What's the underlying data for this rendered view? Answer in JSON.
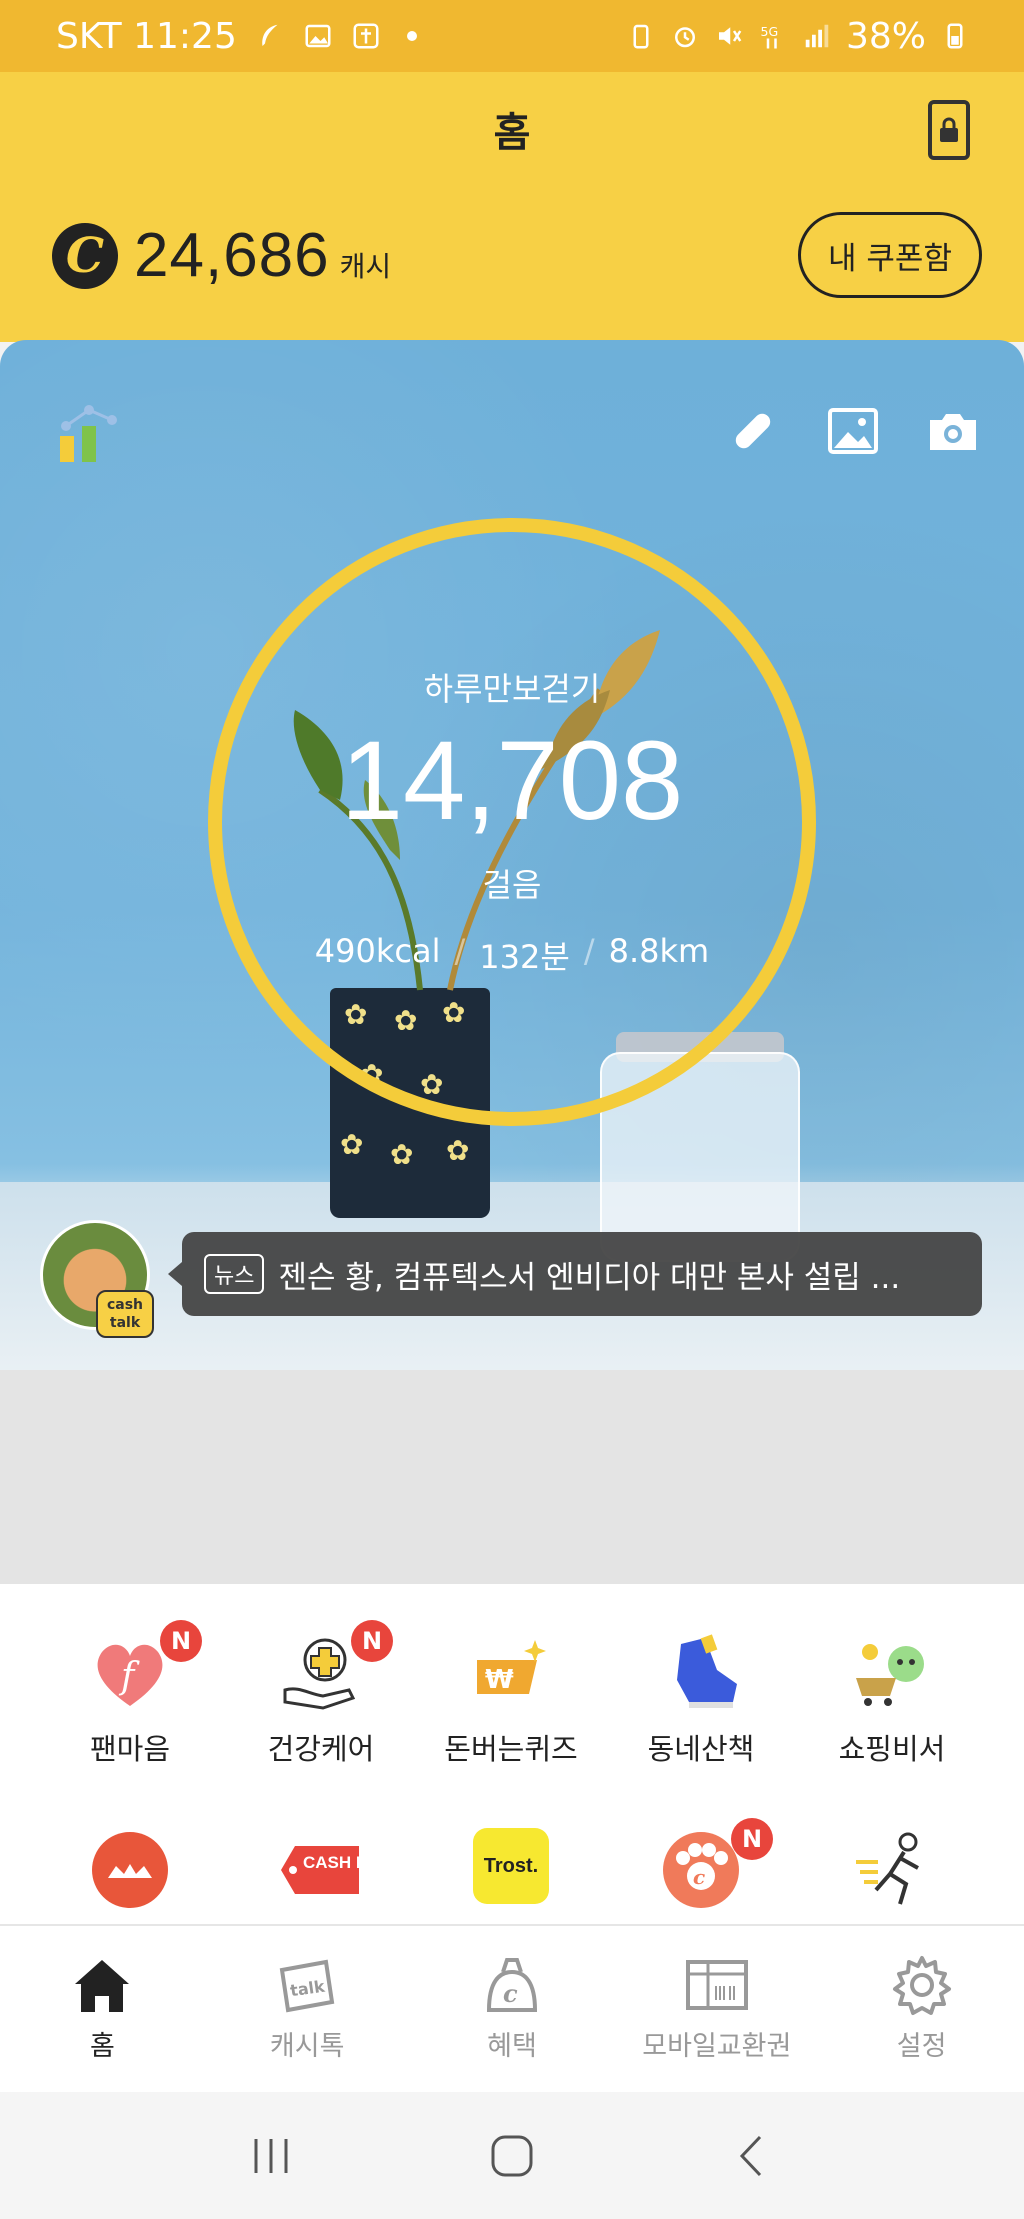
{
  "status_bar": {
    "carrier_time": "SKT 11:25",
    "battery": "38%",
    "network": "5G"
  },
  "header": {
    "title": "홈",
    "cash_amount": "24,686",
    "cash_unit": "캐시",
    "cash_icon_letter": "C",
    "coupon_button": "내 쿠폰함"
  },
  "walk": {
    "title": "하루만보걷기",
    "steps": "14,708",
    "unit": "걸음",
    "kcal": "490kcal",
    "minutes": "132분",
    "distance": "8.8km",
    "separator": "/"
  },
  "news": {
    "tag": "뉴스",
    "headline": "젠슨 황, 컴퓨텍스서 엔비디아 대만 본사 설립 ...",
    "badge_line1": "cash",
    "badge_line2": "talk"
  },
  "menu": {
    "row1": [
      {
        "label": "팬마음",
        "icon": "heart-f-icon",
        "badge": "N"
      },
      {
        "label": "건강케어",
        "icon": "health-care-icon",
        "badge": "N"
      },
      {
        "label": "돈버는퀴즈",
        "icon": "quiz-icon",
        "badge": ""
      },
      {
        "label": "동네산책",
        "icon": "sneaker-icon",
        "badge": ""
      },
      {
        "label": "쇼핑비서",
        "icon": "shopping-cart-icon",
        "badge": ""
      }
    ],
    "row2": [
      {
        "label": "",
        "icon": "orange-app-icon",
        "badge": ""
      },
      {
        "label": "CASH DEAL",
        "icon": "cash-deal-icon",
        "badge": ""
      },
      {
        "label": "Trost.",
        "icon": "trost-icon",
        "badge": ""
      },
      {
        "label": "",
        "icon": "pet-cash-icon",
        "badge": "N"
      },
      {
        "label": "",
        "icon": "runner-icon",
        "badge": ""
      }
    ]
  },
  "bottom_nav": [
    {
      "label": "홈",
      "icon": "home-icon",
      "active": true
    },
    {
      "label": "캐시톡",
      "icon": "talk-icon",
      "active": false
    },
    {
      "label": "혜택",
      "icon": "benefit-icon",
      "active": false
    },
    {
      "label": "모바일교환권",
      "icon": "voucher-icon",
      "active": false
    },
    {
      "label": "설정",
      "icon": "settings-icon",
      "active": false
    }
  ],
  "colors": {
    "accent": "#f7d045",
    "ring": "#f4cc3a",
    "badge": "#e8453c",
    "status_bar": "#f0b830"
  }
}
